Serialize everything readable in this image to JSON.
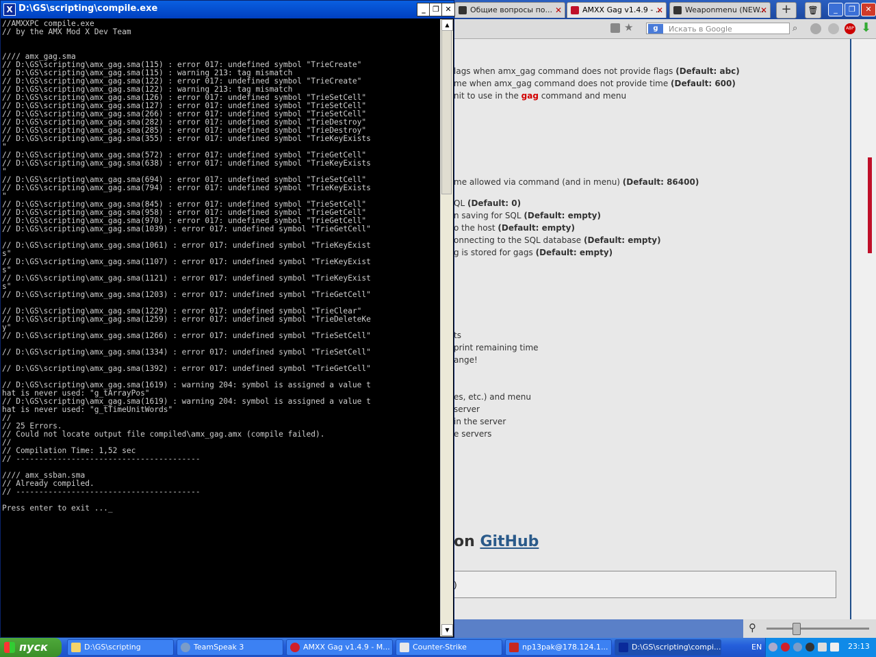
{
  "console": {
    "title": "D:\\GS\\scripting\\compile.exe",
    "lines": [
      "//AMXXPC compile.exe",
      "// by the AMX Mod X Dev Team",
      "",
      "",
      "//// amx_gag.sma",
      "// D:\\GS\\scripting\\amx_gag.sma(115) : error 017: undefined symbol \"TrieCreate\"",
      "// D:\\GS\\scripting\\amx_gag.sma(115) : warning 213: tag mismatch",
      "// D:\\GS\\scripting\\amx_gag.sma(122) : error 017: undefined symbol \"TrieCreate\"",
      "// D:\\GS\\scripting\\amx_gag.sma(122) : warning 213: tag mismatch",
      "// D:\\GS\\scripting\\amx_gag.sma(126) : error 017: undefined symbol \"TrieSetCell\"",
      "// D:\\GS\\scripting\\amx_gag.sma(127) : error 017: undefined symbol \"TrieSetCell\"",
      "// D:\\GS\\scripting\\amx_gag.sma(266) : error 017: undefined symbol \"TrieSetCell\"",
      "// D:\\GS\\scripting\\amx_gag.sma(282) : error 017: undefined symbol \"TrieDestroy\"",
      "// D:\\GS\\scripting\\amx_gag.sma(285) : error 017: undefined symbol \"TrieDestroy\"",
      "// D:\\GS\\scripting\\amx_gag.sma(355) : error 017: undefined symbol \"TrieKeyExists",
      "\"",
      "// D:\\GS\\scripting\\amx_gag.sma(572) : error 017: undefined symbol \"TrieGetCell\"",
      "// D:\\GS\\scripting\\amx_gag.sma(638) : error 017: undefined symbol \"TrieKeyExists",
      "\"",
      "// D:\\GS\\scripting\\amx_gag.sma(694) : error 017: undefined symbol \"TrieSetCell\"",
      "// D:\\GS\\scripting\\amx_gag.sma(794) : error 017: undefined symbol \"TrieKeyExists",
      "\"",
      "// D:\\GS\\scripting\\amx_gag.sma(845) : error 017: undefined symbol \"TrieSetCell\"",
      "// D:\\GS\\scripting\\amx_gag.sma(958) : error 017: undefined symbol \"TrieGetCell\"",
      "// D:\\GS\\scripting\\amx_gag.sma(970) : error 017: undefined symbol \"TrieGetCell\"",
      "// D:\\GS\\scripting\\amx_gag.sma(1039) : error 017: undefined symbol \"TrieGetCell\"",
      "",
      "// D:\\GS\\scripting\\amx_gag.sma(1061) : error 017: undefined symbol \"TrieKeyExist",
      "s\"",
      "// D:\\GS\\scripting\\amx_gag.sma(1107) : error 017: undefined symbol \"TrieKeyExist",
      "s\"",
      "// D:\\GS\\scripting\\amx_gag.sma(1121) : error 017: undefined symbol \"TrieKeyExist",
      "s\"",
      "// D:\\GS\\scripting\\amx_gag.sma(1203) : error 017: undefined symbol \"TrieGetCell\"",
      "",
      "// D:\\GS\\scripting\\amx_gag.sma(1229) : error 017: undefined symbol \"TrieClear\"",
      "// D:\\GS\\scripting\\amx_gag.sma(1259) : error 017: undefined symbol \"TrieDeleteKe",
      "y\"",
      "// D:\\GS\\scripting\\amx_gag.sma(1266) : error 017: undefined symbol \"TrieSetCell\"",
      "",
      "// D:\\GS\\scripting\\amx_gag.sma(1334) : error 017: undefined symbol \"TrieSetCell\"",
      "",
      "// D:\\GS\\scripting\\amx_gag.sma(1392) : error 017: undefined symbol \"TrieGetCell\"",
      "",
      "// D:\\GS\\scripting\\amx_gag.sma(1619) : warning 204: symbol is assigned a value t",
      "hat is never used: \"g_tArrayPos\"",
      "// D:\\GS\\scripting\\amx_gag.sma(1619) : warning 204: symbol is assigned a value t",
      "hat is never used: \"g_tTimeUnitWords\"",
      "//",
      "// 25 Errors.",
      "// Could not locate output file compiled\\amx_gag.amx (compile failed).",
      "//",
      "// Compilation Time: 1,52 sec",
      "// ----------------------------------------",
      "",
      "//// amx_ssban.sma",
      "// Already compiled.",
      "// ----------------------------------------",
      "",
      "Press enter to exit ..._"
    ]
  },
  "browser": {
    "tabs": [
      {
        "label": "Общие вопросы по...",
        "icon_color": "#333333"
      },
      {
        "label": "AMXX Gag v1.4.9 - ...",
        "icon_color": "#c0102a"
      },
      {
        "label": "Weaponmenu (NEW...",
        "icon_color": "#333333"
      }
    ],
    "search_placeholder": "Искать в Google",
    "search_engine_label": "g",
    "content_lines": [
      {
        "pre": "lags when amx_gag command does not provide flags ",
        "bold": "(Default: abc)"
      },
      {
        "pre": "me when amx_gag command does not provide time ",
        "bold": "(Default: 600)"
      },
      {
        "pre": "nit to use in the ",
        "red": "gag",
        "post": " command and menu"
      },
      {
        "pre": "me allowed via command (and in menu) ",
        "bold": "(Default: 86400)"
      },
      {
        "pre": "QL ",
        "bold": "(Default: 0)"
      },
      {
        "pre": "n saving for SQL ",
        "bold": "(Default: empty)"
      },
      {
        "pre": "o the host ",
        "bold": "(Default: empty)"
      },
      {
        "pre": "onnecting to the SQL database ",
        "bold": "(Default: empty)"
      },
      {
        "pre": "g is stored for gags ",
        "bold": "(Default: empty)"
      },
      {
        "pre": "ts"
      },
      {
        "pre": "print remaining time"
      },
      {
        "pre": "ange!"
      },
      {
        "pre": "es, etc.) and menu"
      },
      {
        "pre": "server"
      },
      {
        "pre": "in the server"
      },
      {
        "pre": "e servers"
      }
    ],
    "github_prefix": "on ",
    "github_link": "GitHub",
    "code_box_text": ")"
  },
  "taskbar": {
    "start_label": "пуск",
    "tasks": [
      {
        "label": "D:\\GS\\scripting",
        "icon_color": "#f5d36b"
      },
      {
        "label": "TeamSpeak 3",
        "icon_color": "#7a9cc8"
      },
      {
        "label": "AMXX Gag v1.4.9 - M...",
        "icon_color": "#d01f2a"
      },
      {
        "label": "Counter-Strike",
        "icon_color": "#e8e8e8"
      },
      {
        "label": "np13pak@178.124.1...",
        "icon_color": "#c8281e"
      },
      {
        "label": "D:\\GS\\scripting\\compi...",
        "icon_color": "#0a2a9a"
      }
    ],
    "language": "EN",
    "clock": "23:13",
    "tray_icons": [
      "network-icon",
      "opera-icon",
      "teamspeak-icon",
      "steam-icon",
      "volume-icon",
      "display-icon"
    ]
  }
}
